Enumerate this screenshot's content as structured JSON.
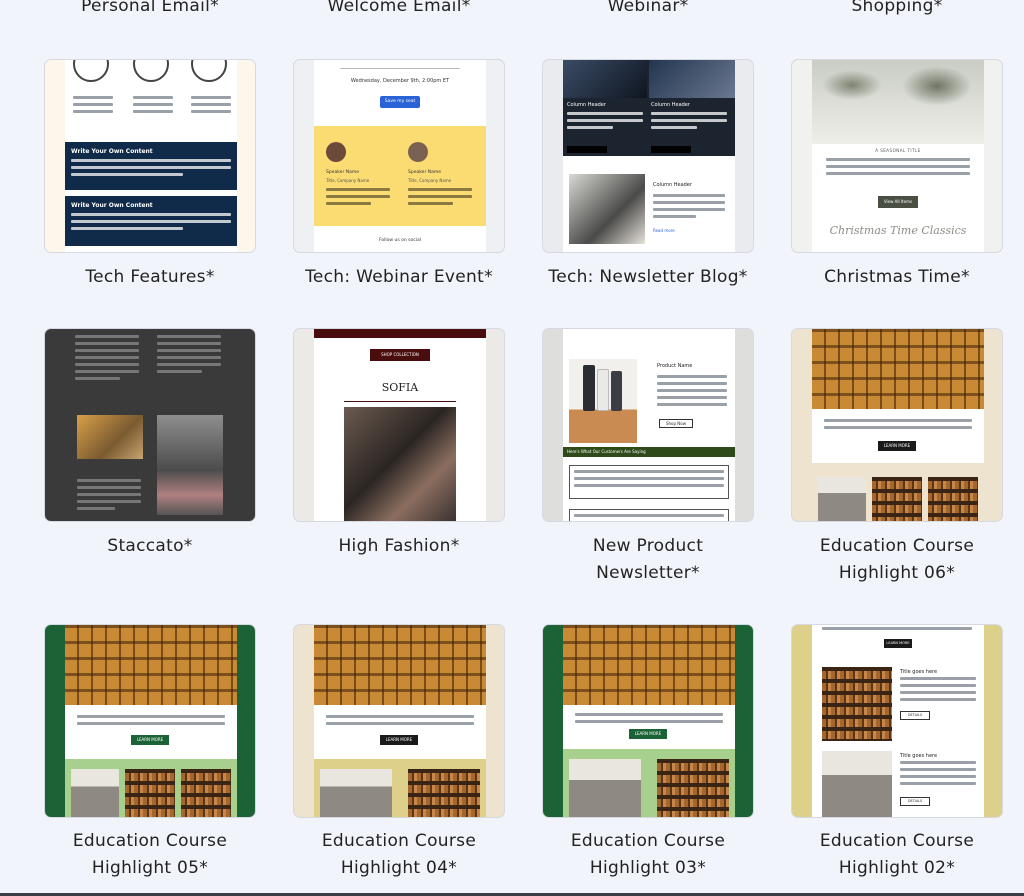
{
  "top_row": [
    "Personal Email*",
    "Welcome Email*",
    "Webinar*",
    "Shopping*"
  ],
  "templates": [
    {
      "name": "Tech Features*"
    },
    {
      "name": "Tech: Webinar Event*"
    },
    {
      "name": "Tech: Newsletter Blog*"
    },
    {
      "name": "Christmas Time*"
    },
    {
      "name": "Staccato*"
    },
    {
      "name": "High Fashion*"
    },
    {
      "name": "New Product Newsletter*"
    },
    {
      "name": "Education Course Highlight 06*"
    },
    {
      "name": "Education Course Highlight 05*"
    },
    {
      "name": "Education Course Highlight 04*"
    },
    {
      "name": "Education Course Highlight 03*"
    },
    {
      "name": "Education Course Highlight 02*"
    }
  ],
  "thumb_text": {
    "tech_features_heading1": "Write Your Own Content",
    "tech_features_heading2": "Write Your Own Content",
    "webinar_date": "Wednesday, December 9th, 2:00pm ET",
    "webinar_button": "Save my seat",
    "webinar_speaker": "Speaker Name",
    "webinar_company": "Title, Company Name",
    "webinar_footer": "Follow us on social",
    "newsletter_col1": "Column Header",
    "newsletter_col2": "Column Header",
    "newsletter_col3": "Column Header",
    "newsletter_btn": "Read more",
    "christmas_label": "A SEASONAL TITLE",
    "christmas_button": "View All Items",
    "christmas_script": "Christmas Time Classics",
    "fashion_shop": "SHOP COLLECTION",
    "fashion_title": "SOFIA",
    "product_title": "Product Name",
    "product_btn": "Shop Now",
    "product_banner": "Here's What Our Customers Are Saying",
    "edu_learn": "LEARN MORE",
    "edu_title1": "Title goes here",
    "edu_title2": "Title goes here",
    "edu_details": "DETAILS"
  },
  "colors": {
    "page_bg": "#f1f4fb",
    "edu_green": "#1b6336",
    "edu_beige": "#ede3cf",
    "edu_gold": "#ddd08a",
    "tech_navy": "#102a4a",
    "webinar_yellow": "#fbdc73",
    "fashion_maroon": "#4a0d0d"
  }
}
